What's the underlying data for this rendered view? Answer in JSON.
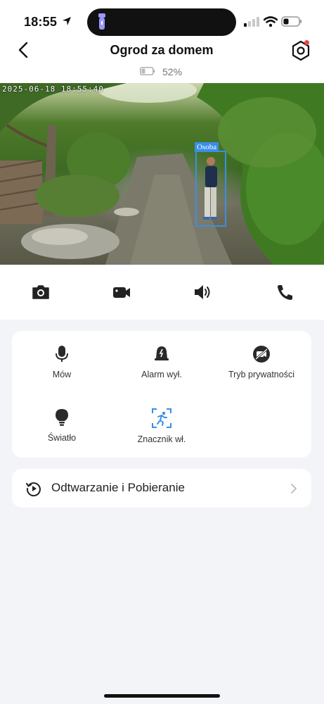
{
  "status_bar": {
    "time": "18:55"
  },
  "header": {
    "title": "Ogrod za domem",
    "battery_percent": "52%"
  },
  "camera": {
    "timestamp": "2025-06-18 18:55:40",
    "detection_label": "Osoba"
  },
  "action_icons": [
    "camera-icon",
    "video-record-icon",
    "speaker-icon",
    "phone-icon"
  ],
  "controls": [
    {
      "label": "Mów",
      "icon": "microphone-icon"
    },
    {
      "label": "Alarm wył.",
      "icon": "alarm-bell-icon"
    },
    {
      "label": "Tryb prywatności",
      "icon": "privacy-camera-off-icon"
    },
    {
      "label": "Światło",
      "icon": "lightbulb-icon"
    },
    {
      "label": "Znacznik wł.",
      "icon": "motion-marker-icon"
    }
  ],
  "playback": {
    "label": "Odtwarzanie i Pobieranie"
  },
  "colors": {
    "accent_blue": "#3a8ee6",
    "notification_red": "#f0434a",
    "background": "#f3f4f7"
  }
}
